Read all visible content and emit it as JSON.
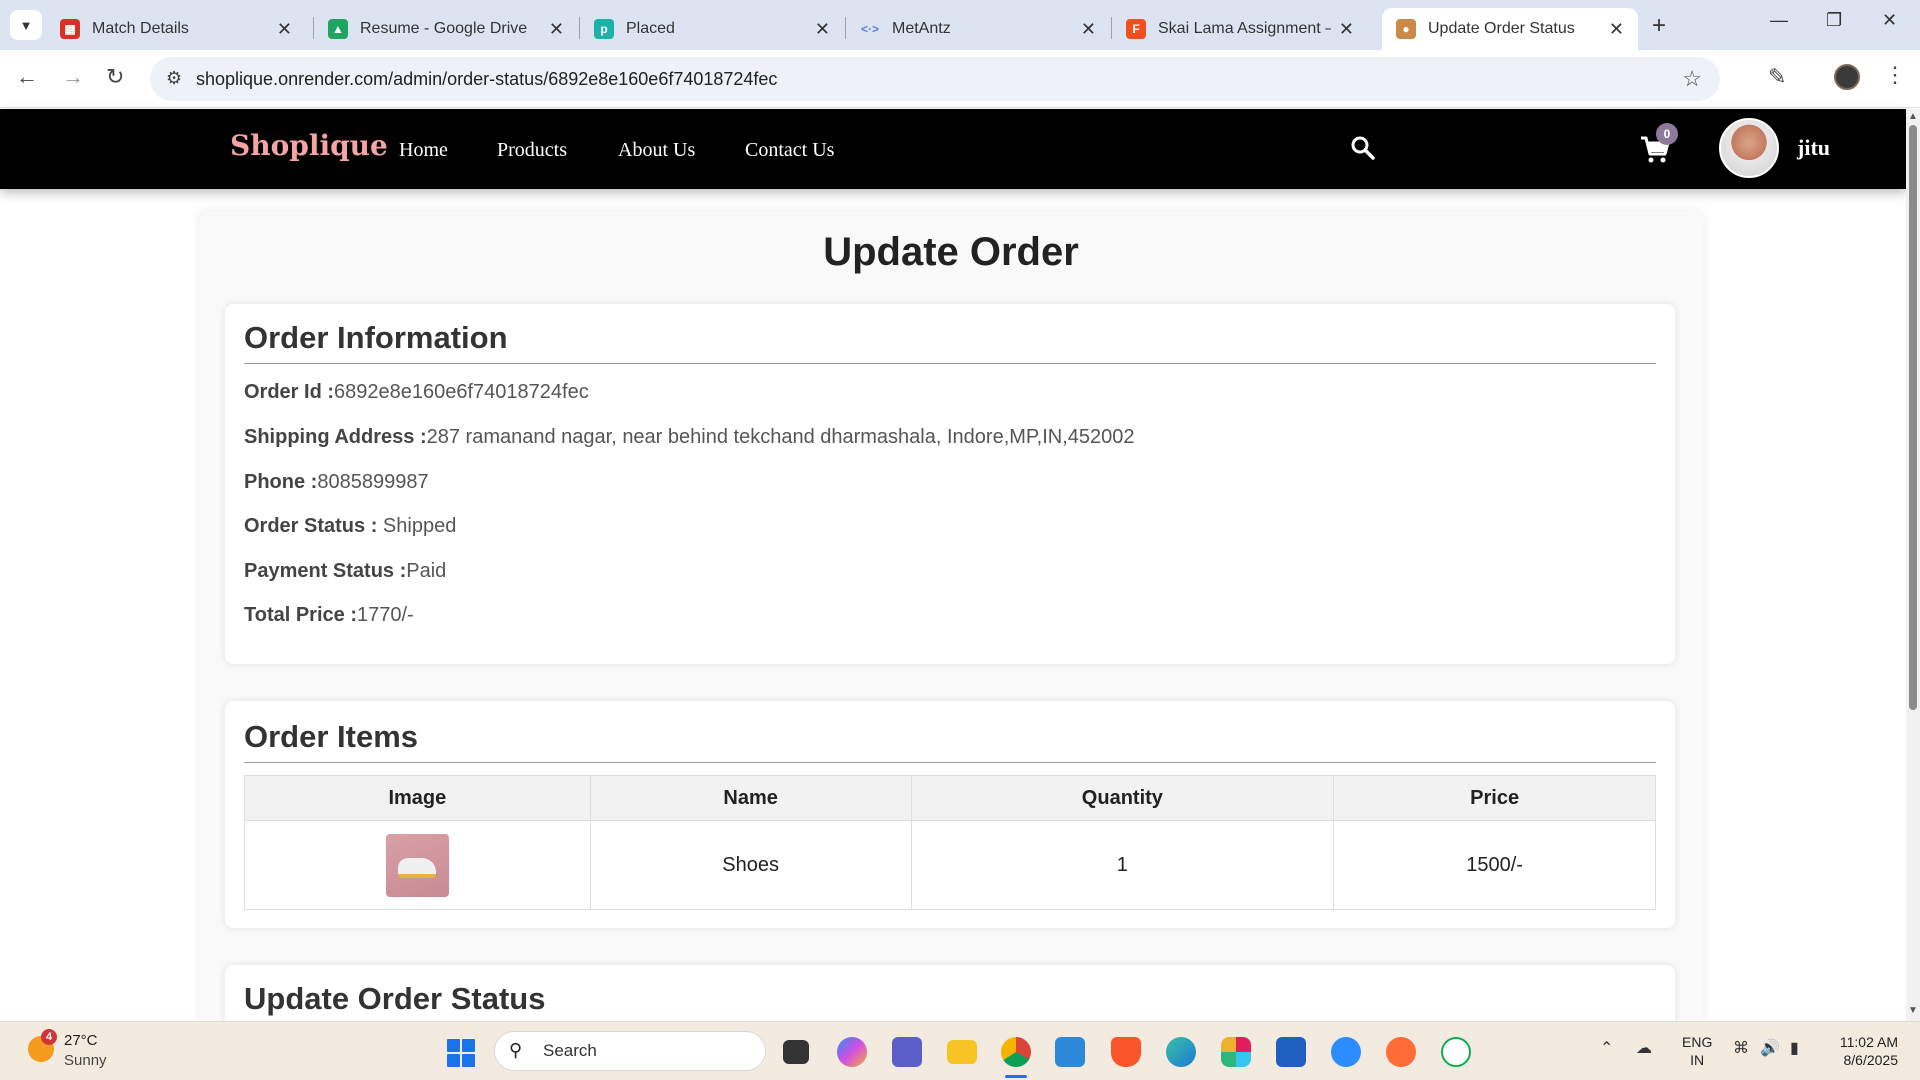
{
  "browser": {
    "tabs": [
      {
        "title": "Match Details",
        "icon": "match-icon",
        "color": "#d93025"
      },
      {
        "title": "Resume - Google Drive",
        "icon": "google-drive-icon",
        "color": "#1fa463"
      },
      {
        "title": "Placed",
        "icon": "placed-icon",
        "color": "#1ab3a6"
      },
      {
        "title": "MetAntz",
        "icon": "metantz-icon",
        "color": "#5b7fd6"
      },
      {
        "title": "Skai Lama Assignment – Fi",
        "icon": "figma-icon",
        "color": "#f24e1e"
      },
      {
        "title": "Update Order Status",
        "icon": "shoplique-icon",
        "color": "#c98a4a",
        "active": true
      }
    ],
    "url": "shoplique.onrender.com/admin/order-status/6892e8e160e6f74018724fec"
  },
  "site": {
    "brand": "Shoplique",
    "nav": [
      "Home",
      "Products",
      "About Us",
      "Contact Us"
    ],
    "cart_count": "0",
    "username": "jitu"
  },
  "page": {
    "title": "Update Order"
  },
  "order_info": {
    "heading": "Order Information",
    "fields": [
      {
        "label": "Order Id :",
        "value": "6892e8e160e6f74018724fec"
      },
      {
        "label": "Shipping Address :",
        "value": "287 ramanand nagar, near behind tekchand dharmashala, Indore,MP,IN,452002"
      },
      {
        "label": "Phone :",
        "value": "8085899987"
      },
      {
        "label": "Order Status :",
        "value": " Shipped"
      },
      {
        "label": "Payment Status :",
        "value": "Paid"
      },
      {
        "label": "Total Price :",
        "value": "1770/-"
      }
    ]
  },
  "order_items": {
    "heading": "Order Items",
    "columns": [
      "Image",
      "Name",
      "Quantity",
      "Price"
    ],
    "rows": [
      {
        "name": "Shoes",
        "quantity": "1",
        "price": "1500/-"
      }
    ]
  },
  "update_status": {
    "heading": "Update Order Status"
  },
  "taskbar": {
    "weather_temp": "27°C",
    "weather_desc": "Sunny",
    "weather_badge": "4",
    "search_placeholder": "Search",
    "lang_line1": "ENG",
    "lang_line2": "IN",
    "time": "11:02 AM",
    "date": "8/6/2025"
  }
}
